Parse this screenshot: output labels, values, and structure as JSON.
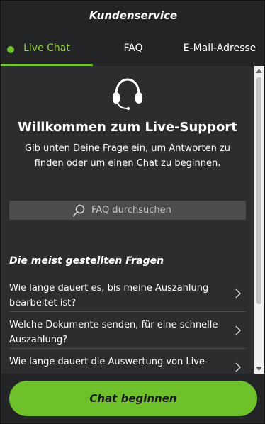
{
  "header": {
    "title": "Kundenservice"
  },
  "tabs": [
    {
      "label": "Live Chat",
      "active": true
    },
    {
      "label": "FAQ",
      "active": false
    },
    {
      "label": "E-Mail-Adresse",
      "active": false
    }
  ],
  "main": {
    "welcome_title": "Willkommen zum Live-Support",
    "welcome_text": "Gib unten Deine Frage ein, um Antworten zu finden oder um einen Chat zu beginnen.",
    "search_placeholder": "FAQ durchsuchen",
    "faq_heading": "Die meist gestellten Fragen",
    "faq_items": [
      "Wie lange dauert es, bis meine Auszahlung bearbeitet ist?",
      "Welche Dokumente senden, für eine schnelle Auszahlung?",
      "Wie lange dauert die Auswertung von Live-"
    ]
  },
  "footer": {
    "chat_button": "Chat beginnen"
  },
  "colors": {
    "accent": "#6fc12c",
    "background": "#2b2d2e",
    "header_bg": "#222425"
  },
  "icons": {
    "support": "headset-icon",
    "search": "search-icon",
    "chevron": "chevron-right-icon",
    "online": "online-status-dot"
  }
}
